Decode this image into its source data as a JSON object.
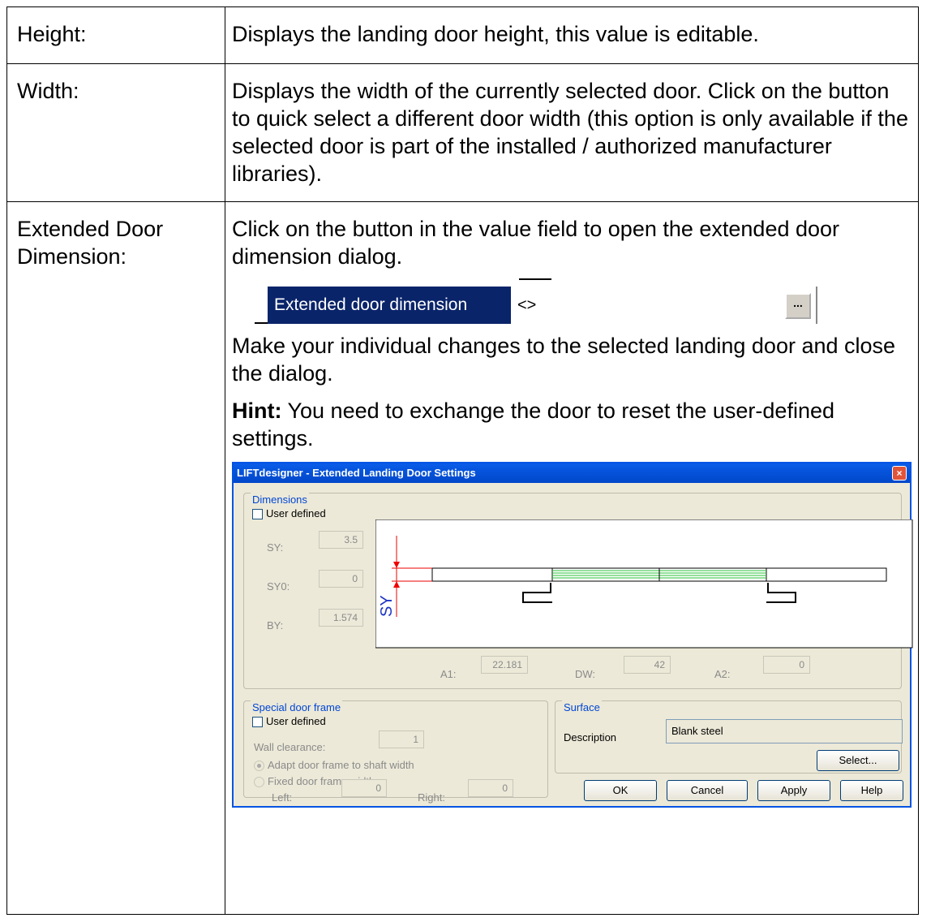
{
  "rows": [
    {
      "term": "Height:",
      "desc": "Displays the landing door height, this value is editable."
    },
    {
      "term": "Width:",
      "desc": "Displays the width of the currently selected door. Click on the button to quick select a different door width (this option is only available if the selected door is part of the installed / authorized manufacturer libraries)."
    },
    {
      "term": "Extended Door Dimension:",
      "intro": "Click on the button in the value field to open the extended door dimension dialog.",
      "after": "Make your individual changes to the selected landing door and close the dialog.",
      "hint_label": "Hint:",
      "hint_text": " You need to exchange the door to reset the user-defined settings."
    }
  ],
  "property_row": {
    "label": "Extended door dimension",
    "value": "<>",
    "button": "..."
  },
  "dialog": {
    "title": "LIFTdesigner - Extended Landing Door Settings",
    "close": "×",
    "dimensions": {
      "group": "Dimensions",
      "user_defined": "User defined",
      "sy_label": "SY:",
      "sy": "3.5",
      "sy0_label": "SY0:",
      "sy0": "0",
      "by_label": "BY:",
      "by": "1.574",
      "a1_label": "A1:",
      "a1": "22.181",
      "dw_label": "DW:",
      "dw": "42",
      "a2_label": "A2:",
      "a2": "0",
      "sketch_label": "SY"
    },
    "frame": {
      "group": "Special door frame",
      "user_defined": "User defined",
      "wall_label": "Wall clearance:",
      "wall": "1",
      "opt1": "Adapt door frame to shaft width",
      "opt2": "Fixed door frame widths",
      "left_label": "Left:",
      "left": "0",
      "right_label": "Right:",
      "right": "0"
    },
    "surface": {
      "group": "Surface",
      "desc_label": "Description",
      "desc": "Blank steel",
      "select": "Select..."
    },
    "buttons": {
      "ok": "OK",
      "cancel": "Cancel",
      "apply": "Apply",
      "help": "Help"
    }
  }
}
